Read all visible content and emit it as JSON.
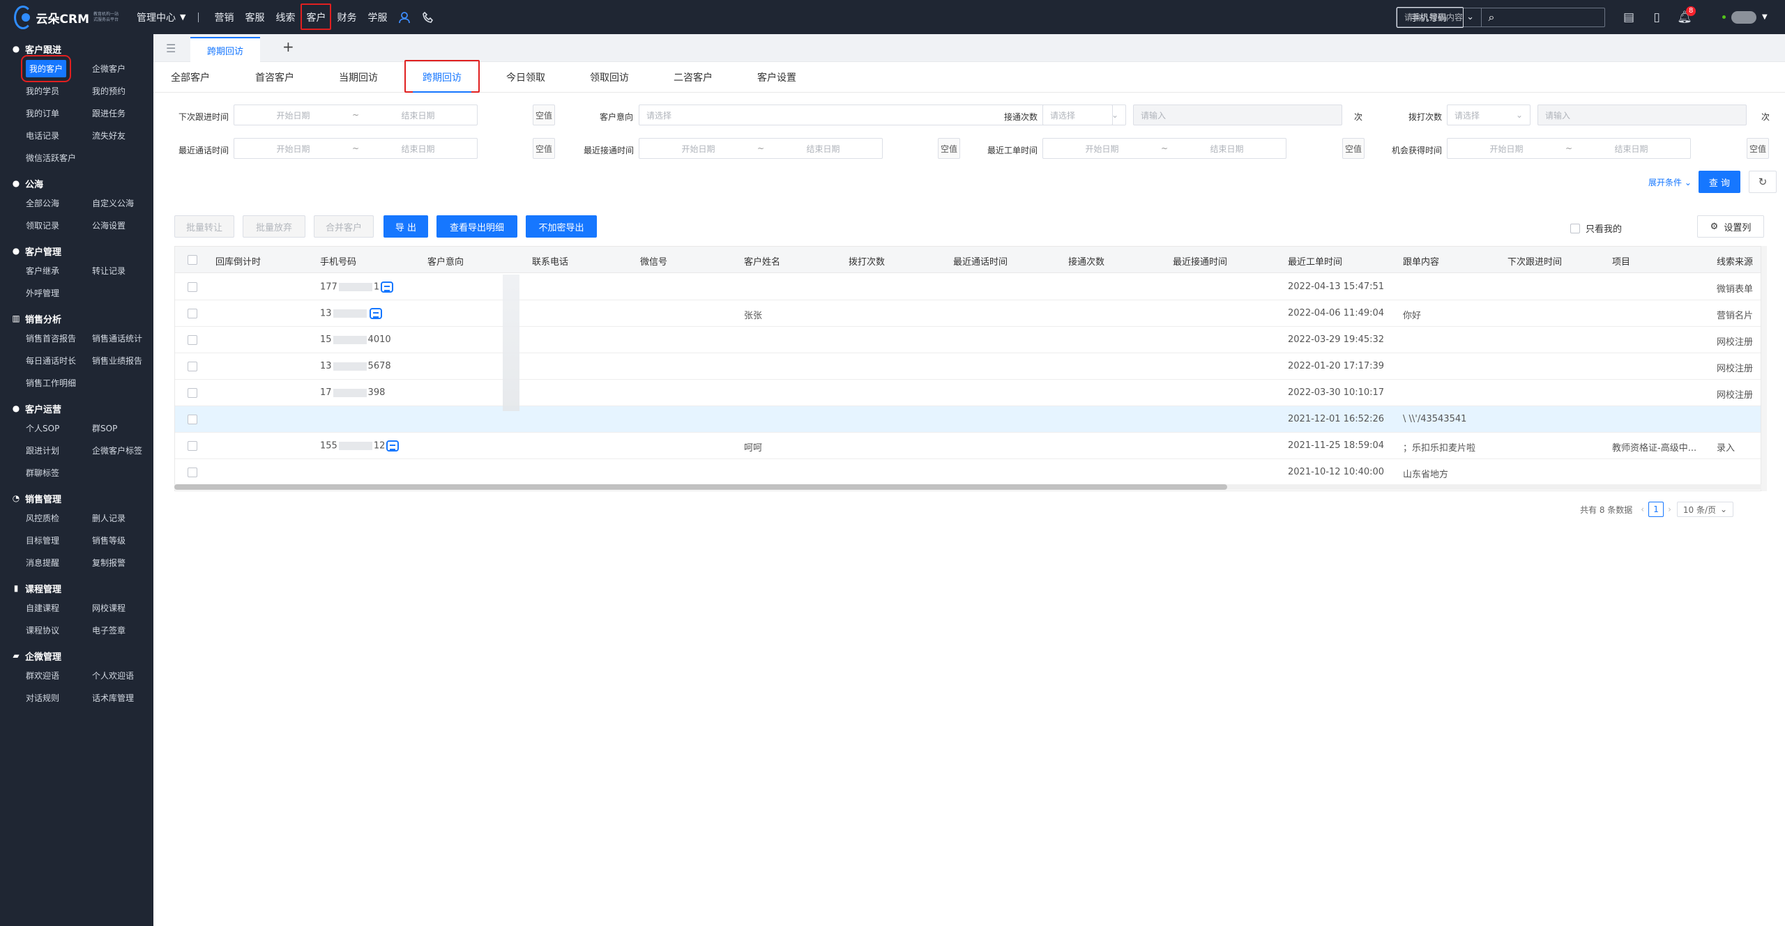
{
  "brand": {
    "name": "云朵CRM",
    "slogan_line1": "教育机构一站",
    "slogan_line2": "式服务云平台"
  },
  "topnav": {
    "manage_center": "管理中心",
    "items": [
      "营销",
      "客服",
      "线索",
      "客户",
      "财务",
      "学服"
    ],
    "active": "客户"
  },
  "search": {
    "type": "手机号码",
    "placeholder": "请输入搜索内容"
  },
  "notifications": {
    "count": "8"
  },
  "sidebar": [
    {
      "title": "客户跟进",
      "items": [
        "我的客户",
        "企微客户",
        "我的学员",
        "我的预约",
        "我的订单",
        "跟进任务",
        "电话记录",
        "流失好友",
        "微信活跃客户"
      ]
    },
    {
      "title": "公海",
      "items": [
        "全部公海",
        "自定义公海",
        "领取记录",
        "公海设置"
      ]
    },
    {
      "title": "客户管理",
      "items": [
        "客户继承",
        "转让记录",
        "外呼管理"
      ]
    },
    {
      "title": "销售分析",
      "items": [
        "销售首咨报告",
        "销售通话统计",
        "每日通话时长",
        "销售业绩报告",
        "销售工作明细"
      ]
    },
    {
      "title": "客户运营",
      "items": [
        "个人SOP",
        "群SOP",
        "跟进计划",
        "企微客户标签",
        "群聊标签"
      ]
    },
    {
      "title": "销售管理",
      "items": [
        "风控质检",
        "删人记录",
        "目标管理",
        "销售等级",
        "消息提醒",
        "复制报警"
      ]
    },
    {
      "title": "课程管理",
      "items": [
        "自建课程",
        "网校课程",
        "课程协议",
        "电子签章"
      ]
    },
    {
      "title": "企微管理",
      "items": [
        "群欢迎语",
        "个人欢迎语",
        "对话规则",
        "话术库管理"
      ]
    }
  ],
  "page_tab": "跨期回访",
  "subtabs": [
    "全部客户",
    "首咨客户",
    "当期回访",
    "跨期回访",
    "今日领取",
    "领取回访",
    "二咨客户",
    "客户设置"
  ],
  "active_subtab": "跨期回访",
  "filters": {
    "next_follow": "下次跟进时间",
    "intent": "客户意向",
    "connect_count": "接通次数",
    "dial_count": "拨打次数",
    "last_call": "最近通话时间",
    "last_connect": "最近接通时间",
    "last_ticket": "最近工单时间",
    "chance_time": "机会获得时间",
    "start_date": "开始日期",
    "end_date": "结束日期",
    "null_btn": "空值",
    "please_select": "请选择",
    "please_input": "请输入",
    "unit": "次",
    "range_sep": "~",
    "expand": "展开条件",
    "query": "查 询"
  },
  "actions": [
    "批量转让",
    "批量放弃",
    "合并客户",
    "导 出",
    "查看导出明细",
    "不加密导出"
  ],
  "only_mine": "只看我的",
  "set_columns": "设置列",
  "table": {
    "columns": [
      "回库倒计时",
      "手机号码",
      "客户意向",
      "联系电话",
      "微信号",
      "客户姓名",
      "拨打次数",
      "最近通话时间",
      "接通次数",
      "最近接通时间",
      "最近工单时间",
      "跟单内容",
      "下次跟进时间",
      "项目",
      "线索来源"
    ],
    "rows": [
      {
        "phone_a": "177",
        "phone_b": "1",
        "name": "",
        "ticket": "2022-04-13 15:47:51",
        "content": "",
        "project": "",
        "source": "微销表单",
        "phone_icon": true
      },
      {
        "phone_a": "13",
        "phone_b": "",
        "name": "张张",
        "ticket": "2022-04-06 11:49:04",
        "content": "你好",
        "project": "",
        "source": "营销名片",
        "phone_icon": true
      },
      {
        "phone_a": "15",
        "phone_b": "4010",
        "name": "",
        "ticket": "2022-03-29 19:45:32",
        "content": "",
        "project": "",
        "source": "网校注册",
        "phone_icon": false
      },
      {
        "phone_a": "13",
        "phone_b": "5678",
        "name": "",
        "ticket": "2022-01-20 17:17:39",
        "content": "",
        "project": "",
        "source": "网校注册",
        "phone_icon": false
      },
      {
        "phone_a": "17",
        "phone_b": "398",
        "name": "",
        "ticket": "2022-03-30 10:10:17",
        "content": "",
        "project": "",
        "source": "网校注册",
        "phone_icon": false
      },
      {
        "phone_a": "",
        "phone_b": "",
        "name": "",
        "ticket": "2021-12-01 16:52:26",
        "content": "\\ \\\\'/43543541",
        "project": "",
        "source": "",
        "phone_icon": false
      },
      {
        "phone_a": "155",
        "phone_b": "12",
        "name": "呵呵",
        "ticket": "2021-11-25 18:59:04",
        "content": "；乐扣乐扣麦片啦",
        "project": "教师资格证-高级中...",
        "source": "录入",
        "phone_icon": true
      },
      {
        "phone_a": "",
        "phone_b": "",
        "name": "",
        "ticket": "2021-10-12 10:40:00",
        "content": "山东省地方",
        "project": "",
        "source": "",
        "phone_icon": false
      }
    ]
  },
  "pagination": {
    "total_text": "共有 8 条数据",
    "page": "1",
    "page_size": "10 条/页"
  }
}
